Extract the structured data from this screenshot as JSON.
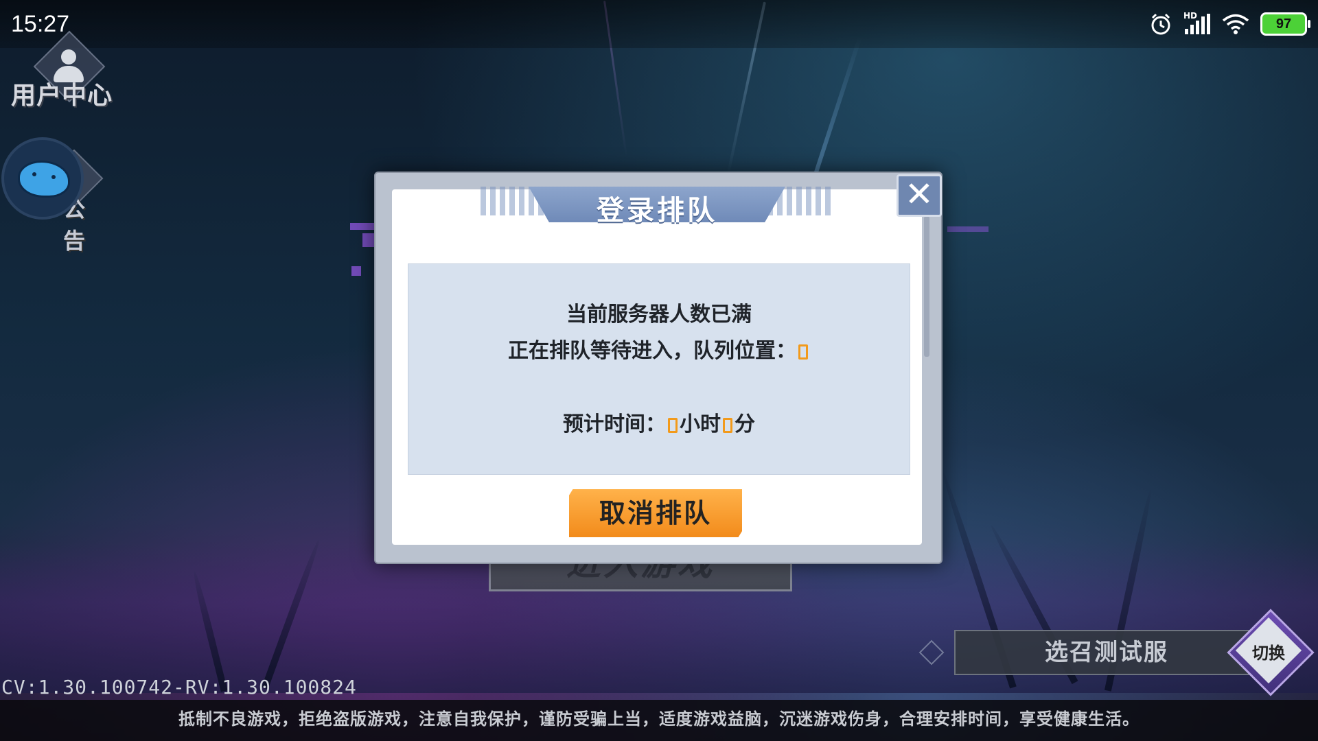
{
  "status_bar": {
    "time": "15:27",
    "network_badge": "HD",
    "battery_level": "97",
    "icons": [
      "alarm-icon",
      "signal-icon",
      "wifi-icon",
      "battery-icon"
    ]
  },
  "sidebar": {
    "user_center_label": "用户中心",
    "notice_label": "公告"
  },
  "background": {
    "enter_game_label": "进入游戏"
  },
  "modal": {
    "title": "登录排队",
    "line1": "当前服务器人数已满",
    "line2": "正在排队等待进入，队列位置：",
    "line3_prefix": "预计时间：",
    "hours_unit": "小时",
    "minutes_unit": "分",
    "cancel_label": "取消排队"
  },
  "server": {
    "name": "选召测试服",
    "switch_label": "切换"
  },
  "version": "CV:1.30.100742-RV:1.30.100824",
  "footer": "抵制不良游戏，拒绝盗版游戏，注意自我保护，谨防受骗上当，适度游戏益脑，沉迷游戏伤身，合理安排时间，享受健康生活。",
  "colors": {
    "accent_orange": "#f29a1b",
    "modal_blue": "#6f87b0",
    "battery_green": "#4cd137"
  }
}
